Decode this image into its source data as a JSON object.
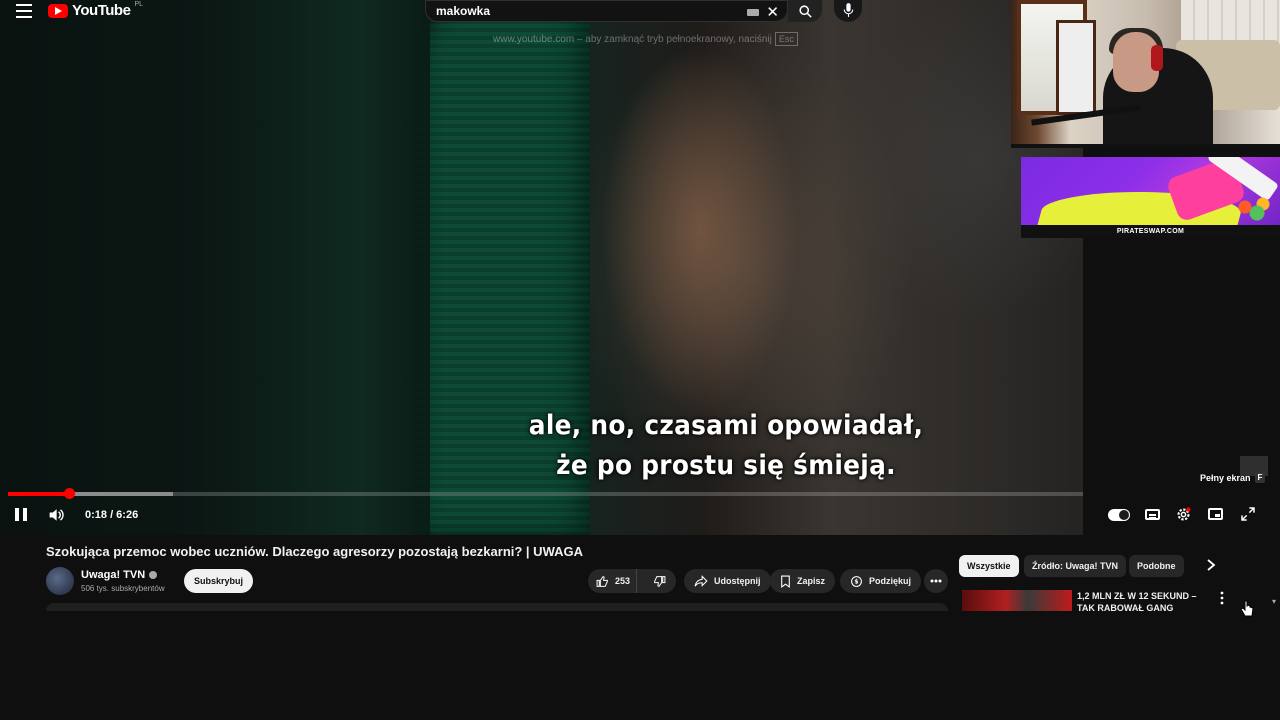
{
  "header": {
    "logo_text": "YouTube",
    "region": "PL",
    "search_value": "makowka",
    "fullscreen_hint": "www.youtube.com – aby zamknąć tryb pełnoekranowy, naciśnij",
    "fullscreen_key": "Esc"
  },
  "ad": {
    "label": "PIRATESWAP.COM"
  },
  "player": {
    "subtitle_line1": "ale, no, czasami opowiadał,",
    "subtitle_line2": "że po prostu się śmieją.",
    "fullscreen_label": "Pełny ekran",
    "fullscreen_key": "F",
    "time": "0:18 / 6:26",
    "progress_fraction": 0.057
  },
  "video": {
    "title": "Szokująca przemoc wobec uczniów. Dlaczego agresorzy pozostają bezkarni? | UWAGA",
    "channel": "Uwaga! TVN",
    "subscribers": "506 tys. subskrybentów",
    "subscribe_label": "Subskrybuj",
    "likes": "253",
    "share_label": "Udostępnij",
    "save_label": "Zapisz",
    "thanks_label": "Podziękuj"
  },
  "sidebar": {
    "chips": [
      "Wszystkie",
      "Źródło: Uwaga! TVN",
      "Podobne"
    ],
    "rec_title": "1,2 MLN ZŁ W 12 SEKUND – TAK RABOWAŁ GANG"
  },
  "colors": {
    "accent": "#ff0000",
    "background": "#0f0f0f",
    "pill": "#272727"
  }
}
